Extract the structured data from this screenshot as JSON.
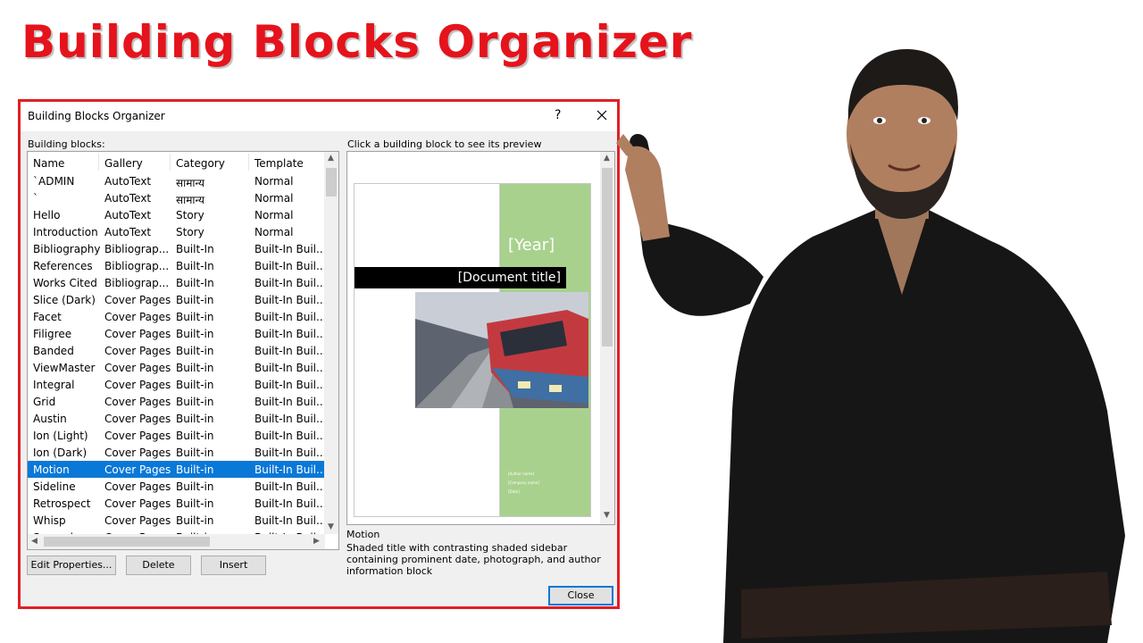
{
  "headline": "Building Blocks Organizer",
  "dialog": {
    "title": "Building Blocks Organizer",
    "help_label": "?",
    "building_blocks_label": "Building blocks:",
    "preview_label": "Click a building block to see its preview",
    "columns": [
      "Name",
      "Gallery",
      "Category",
      "Template"
    ],
    "rows": [
      [
        "`ADMIN",
        "AutoText",
        "सामान्य",
        "Normal"
      ],
      [
        "`",
        "AutoText",
        "सामान्य",
        "Normal"
      ],
      [
        "Hello",
        "AutoText",
        "Story",
        "Normal"
      ],
      [
        "Introduction",
        "AutoText",
        "Story",
        "Normal"
      ],
      [
        "Bibliography",
        "Bibliograp...",
        "Built-In",
        "Built-In Buil..."
      ],
      [
        "References",
        "Bibliograp...",
        "Built-In",
        "Built-In Buil..."
      ],
      [
        "Works Cited",
        "Bibliograp...",
        "Built-In",
        "Built-In Buil..."
      ],
      [
        "Slice (Dark)",
        "Cover Pages",
        "Built-in",
        "Built-In Buil..."
      ],
      [
        "Facet",
        "Cover Pages",
        "Built-in",
        "Built-In Buil..."
      ],
      [
        "Filigree",
        "Cover Pages",
        "Built-in",
        "Built-In Buil..."
      ],
      [
        "Banded",
        "Cover Pages",
        "Built-in",
        "Built-In Buil..."
      ],
      [
        "ViewMaster",
        "Cover Pages",
        "Built-in",
        "Built-In Buil..."
      ],
      [
        "Integral",
        "Cover Pages",
        "Built-in",
        "Built-In Buil..."
      ],
      [
        "Grid",
        "Cover Pages",
        "Built-in",
        "Built-In Buil..."
      ],
      [
        "Austin",
        "Cover Pages",
        "Built-in",
        "Built-In Buil..."
      ],
      [
        "Ion (Light)",
        "Cover Pages",
        "Built-in",
        "Built-In Buil..."
      ],
      [
        "Ion (Dark)",
        "Cover Pages",
        "Built-in",
        "Built-In Buil..."
      ],
      [
        "Motion",
        "Cover Pages",
        "Built-in",
        "Built-In Buil..."
      ],
      [
        "Sideline",
        "Cover Pages",
        "Built-in",
        "Built-In Buil..."
      ],
      [
        "Retrospect",
        "Cover Pages",
        "Built-in",
        "Built-In Buil..."
      ],
      [
        "Whisp",
        "Cover Pages",
        "Built-in",
        "Built-In Buil..."
      ],
      [
        "Semaphore",
        "Cover Pages",
        "Built-in",
        "Built-In Buil..."
      ]
    ],
    "selected_index": 17,
    "buttons": {
      "edit_properties": "Edit Properties...",
      "delete": "Delete",
      "insert": "Insert",
      "close": "Close"
    },
    "preview": {
      "year_placeholder": "[Year]",
      "document_title_placeholder": "[Document title]",
      "author_lines": [
        "[Author name]",
        "[Company name]",
        "[Date]"
      ],
      "sidebar_color": "#a9d18e"
    },
    "selected_name": "Motion",
    "selected_description": "Shaded title with contrasting shaded sidebar containing prominent date, photograph, and author information block"
  },
  "colors": {
    "headline": "#e5131b",
    "frame_border": "#e01f26",
    "selection": "#0a78d7"
  }
}
